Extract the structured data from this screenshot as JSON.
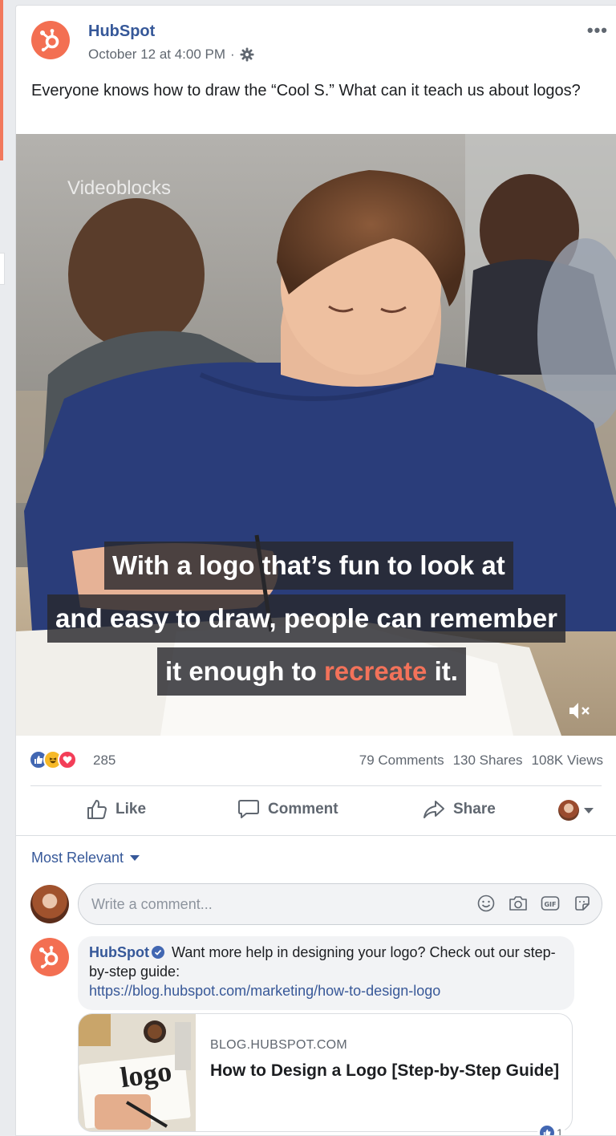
{
  "post": {
    "page_name": "HubSpot",
    "timestamp": "October 12 at 4:00 PM",
    "separator": "·",
    "more_label": "•••",
    "text": "Everyone knows how to draw the “Cool S.” What can it teach us about logos?"
  },
  "video": {
    "watermark": "Videoblocks",
    "caption": {
      "line1": "With a logo that’s fun to look at",
      "line2": "and easy to draw, people can remember",
      "line3_before": "it enough to ",
      "line3_highlight": "recreate",
      "line3_after": " it."
    },
    "muted": true
  },
  "stats": {
    "reactions_count": "285",
    "comments": "79 Comments",
    "shares": "130 Shares",
    "views": "108K Views"
  },
  "actions": {
    "like": "Like",
    "comment": "Comment",
    "share": "Share"
  },
  "comments": {
    "sort_label": "Most Relevant",
    "write_placeholder": "Write a comment...",
    "items": [
      {
        "author": "HubSpot",
        "text": "Want more help in designing your logo? Check out our step-by-step guide:",
        "link": "https://blog.hubspot.com/marketing/how-to-design-logo",
        "preview": {
          "domain": "BLOG.HUBSPOT.COM",
          "title": "How to Design a Logo [Step-by-Step Guide]",
          "thumb_text": "logo"
        },
        "likes": "1"
      }
    ]
  },
  "colors": {
    "brand": "#f36f52",
    "link": "#365899",
    "caption_highlight": "#f3725a"
  }
}
